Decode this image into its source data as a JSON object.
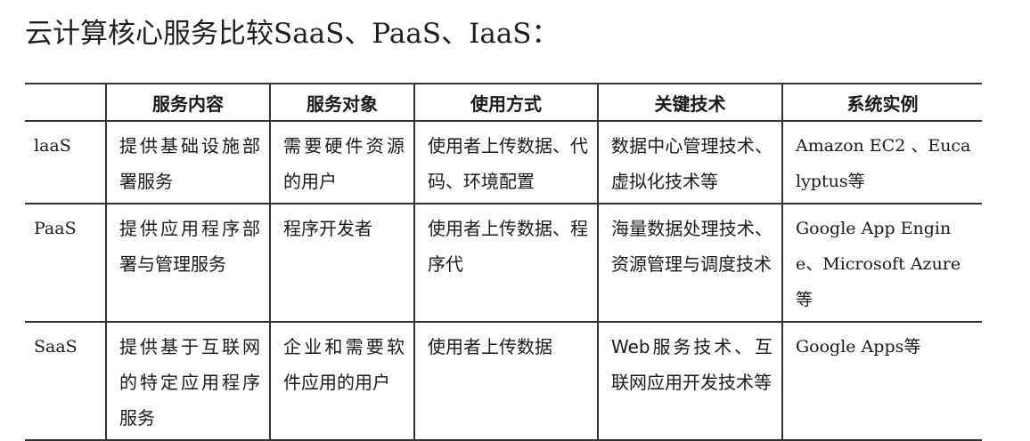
{
  "page": {
    "title": "云计算核心服务比较SaaS、PaaS、IaaS："
  },
  "table": {
    "headers": [
      "",
      "服务内容",
      "服务对象",
      "使用方式",
      "关键技术",
      "系统实例"
    ],
    "rows": [
      {
        "model": "laaS",
        "content": "提供基础设施部署服务",
        "target": "需要硬件资源的用户",
        "usage": "使用者上传数据、代码、环境配置",
        "technology": "数据中心管理技术、虚拟化技术等",
        "examples": "Amazon EC2 、Eucalyptus等"
      },
      {
        "model": "PaaS",
        "content": "提供应用程序部署与管理服务",
        "target": "程序开发者",
        "usage": "使用者上传数据、程序代",
        "technology": "海量数据处理技术、资源管理与调度技术",
        "examples": "Google App Engine、Microsoft Azure等"
      },
      {
        "model": "SaaS",
        "content": "提供基于互联网的特定应用程序服务",
        "target": "企业和需要软件应用的用户",
        "usage": "使用者上传数据",
        "technology": "Web服务技术、互联网应用开发技术等",
        "examples": "Google Apps等"
      }
    ]
  }
}
